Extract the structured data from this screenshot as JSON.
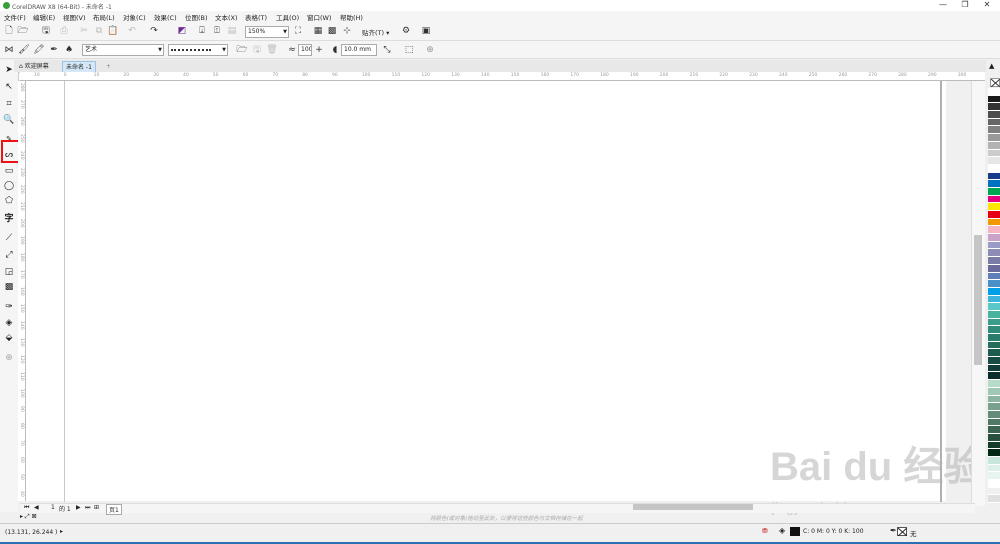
{
  "window": {
    "title": "CorelDRAW X8 (64-Bit) - 未命名 -1",
    "min": "—",
    "restore": "❐",
    "close": "✕"
  },
  "menu": [
    "文件(F)",
    "编辑(E)",
    "视图(V)",
    "布局(L)",
    "对象(C)",
    "效果(C)",
    "位图(B)",
    "文本(X)",
    "表格(T)",
    "工具(O)",
    "窗口(W)",
    "帮助(H)"
  ],
  "toolbar": {
    "zoom": "150%",
    "snap_label": "贴齐(T)",
    "brush_style": "艺术",
    "smoothing": "100",
    "width": "10.0 mm"
  },
  "tabs": {
    "home": "欢迎屏幕",
    "doc": "未命名 -1",
    "add": "+"
  },
  "ruler_h": [
    "10",
    "0",
    "10",
    "20",
    "30",
    "40",
    "50",
    "60",
    "70",
    "80",
    "90",
    "100",
    "110",
    "120",
    "130",
    "140",
    "150",
    "160",
    "170",
    "180",
    "190",
    "200",
    "210",
    "220",
    "230",
    "240",
    "250",
    "260",
    "270",
    "280",
    "290",
    "300",
    "310"
  ],
  "ruler_v": [
    "280",
    "270",
    "260",
    "250",
    "240",
    "230",
    "220",
    "210",
    "200",
    "190",
    "180",
    "170",
    "160",
    "150",
    "140",
    "130",
    "120",
    "110",
    "100",
    "90",
    "80",
    "70",
    "60",
    "50",
    "40"
  ],
  "page_nav": {
    "current": "1",
    "of_label": "的 1",
    "page_tab": "页1"
  },
  "status": {
    "coords": "(13.131, 26.244 )",
    "hint": "将颜色(或对象)拖动至此处，以便将这些颜色与文档存储在一起",
    "fill_info": "C: 0 M: 0 Y: 0 K: 100",
    "outline": "无"
  },
  "palette_colors": [
    "#ffffff",
    "#1a1a1a",
    "#333333",
    "#4d4d4d",
    "#666666",
    "#808080",
    "#999999",
    "#b3b3b3",
    "#cccccc",
    "#e6e6e6",
    "#ffffff",
    "#1a3a8c",
    "#0070c0",
    "#00a651",
    "#e4007f",
    "#ffe600",
    "#e60012",
    "#f39800",
    "#f5b5c5",
    "#c8a2c8",
    "#9b9bc8",
    "#8c8cb4",
    "#7b7ba8",
    "#6a6a9c",
    "#5e7fb8",
    "#4a90c8",
    "#00a0e9",
    "#3cb4dc",
    "#5ac8c8",
    "#48b4a0",
    "#3c9c8c",
    "#308c78",
    "#2a7c6c",
    "#246c5c",
    "#1e5c50",
    "#184c44",
    "#123c38",
    "#0c2c2c",
    "#b4dcc8",
    "#a0c8b4",
    "#8cb4a0",
    "#78a08c",
    "#648c78",
    "#507864",
    "#3c6450",
    "#28503c",
    "#143c28",
    "#002814",
    "#c8e6dc",
    "#dcefe8",
    "#e8f4f0",
    "#ffffff",
    "#f0f0f0",
    "#e0e0e0"
  ],
  "watermark": {
    "main": "Bai du 经验",
    "sub": "jingyan.baidu.com"
  },
  "colors": {
    "highlight": "#e11111",
    "accent": "#2a6fb2"
  }
}
